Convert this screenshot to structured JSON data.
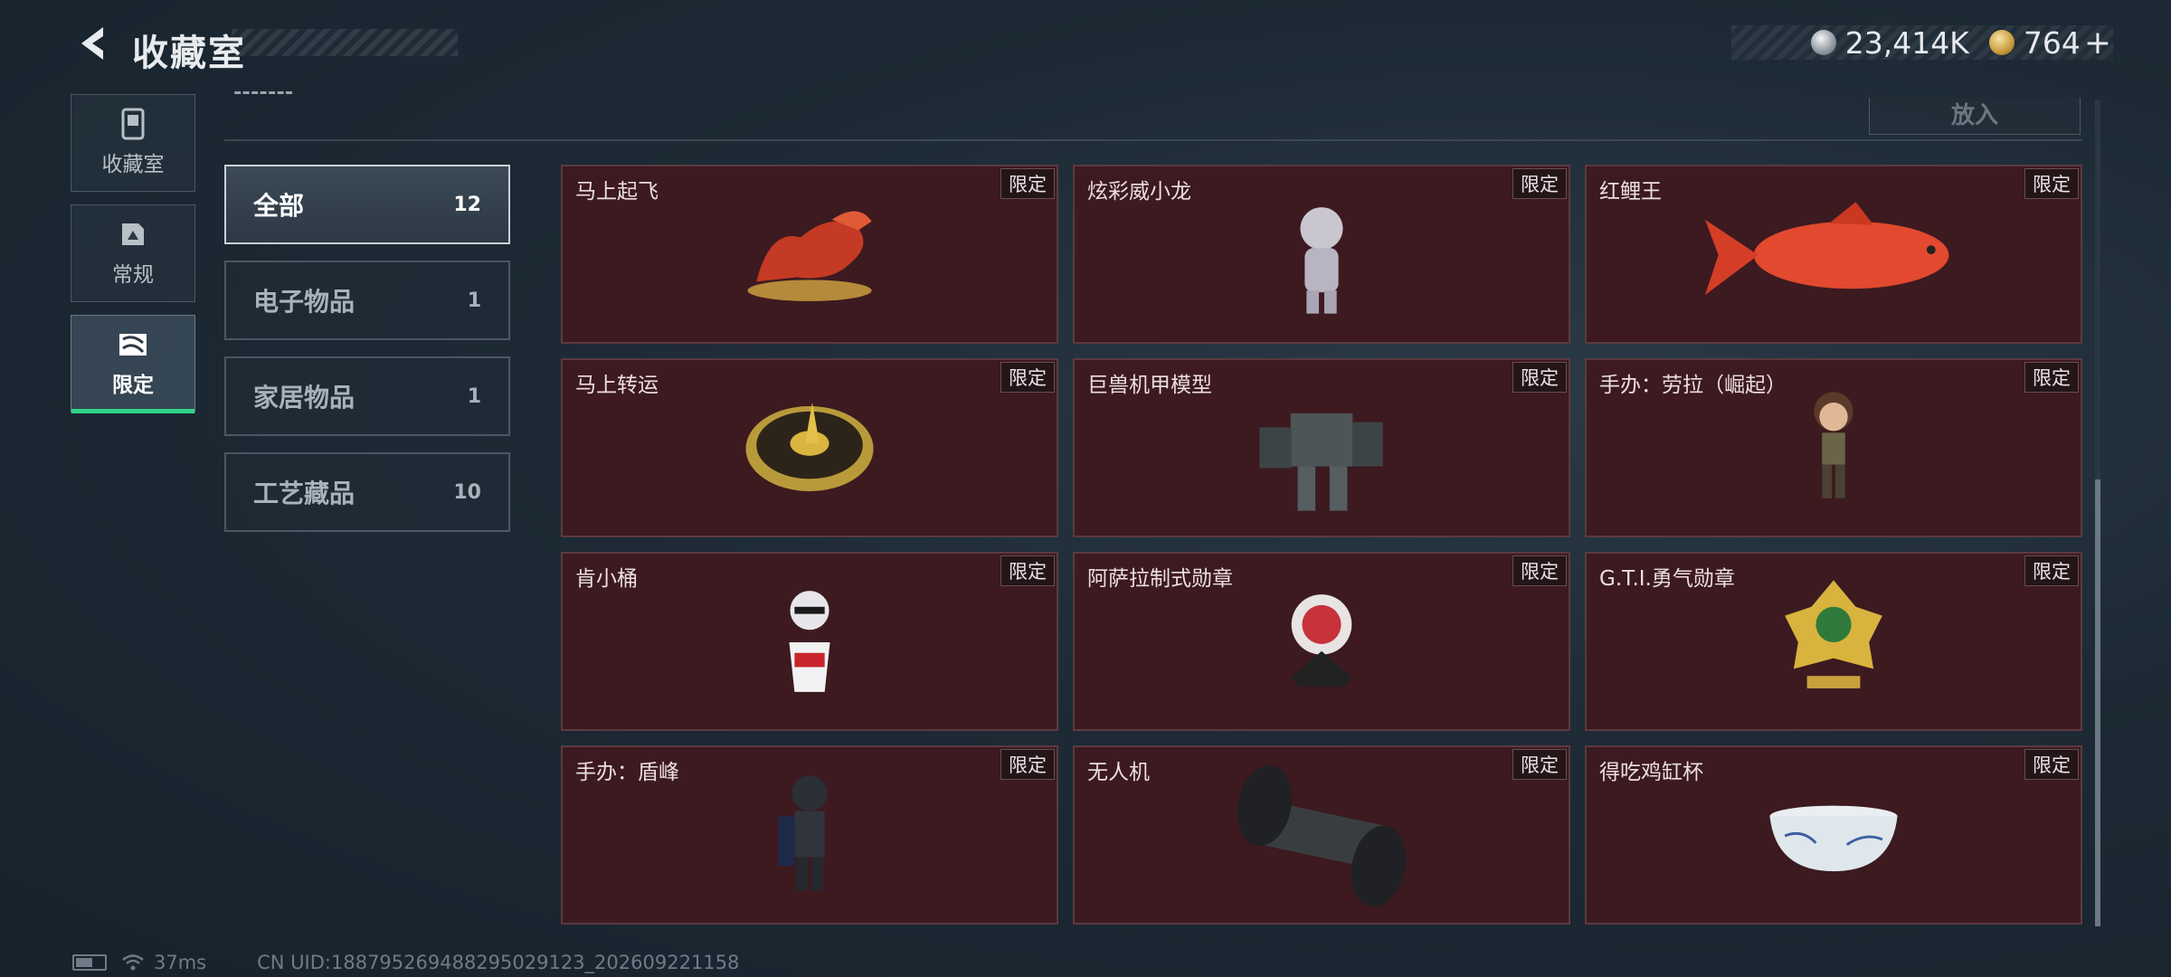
{
  "header": {
    "title": "收藏室",
    "currency": [
      {
        "icon": "silver-coin-icon",
        "value": "23,414K"
      },
      {
        "icon": "gold-coin-icon",
        "value": "764"
      }
    ],
    "add_symbol": "+"
  },
  "side_nav": [
    {
      "label": "收藏室",
      "icon": "collection-icon",
      "active": false
    },
    {
      "label": "常规",
      "icon": "regular-icon",
      "active": false
    },
    {
      "label": "限定",
      "icon": "limited-icon",
      "active": true
    }
  ],
  "toolbar": {
    "put_in_label": "放入"
  },
  "categories": [
    {
      "name": "全部",
      "count": "12",
      "active": true
    },
    {
      "name": "电子物品",
      "count": "1",
      "active": false
    },
    {
      "name": "家居物品",
      "count": "1",
      "active": false
    },
    {
      "name": "工艺藏品",
      "count": "10",
      "active": false
    }
  ],
  "items": [
    {
      "name": "马上起飞",
      "tag": "限定",
      "icon": "red-horse-sculpture-icon"
    },
    {
      "name": "炫彩威小龙",
      "tag": "限定",
      "icon": "silver-dragon-figure-icon"
    },
    {
      "name": "红鲤王",
      "tag": "限定",
      "icon": "red-carp-fish-icon"
    },
    {
      "name": "马上转运",
      "tag": "限定",
      "icon": "golden-horse-spinner-icon"
    },
    {
      "name": "巨兽机甲模型",
      "tag": "限定",
      "icon": "mech-model-icon"
    },
    {
      "name": "手办：劳拉（崛起）",
      "tag": "限定",
      "icon": "lara-figure-icon"
    },
    {
      "name": "肯小桶",
      "tag": "限定",
      "icon": "bucket-figure-icon"
    },
    {
      "name": "阿萨拉制式勋章",
      "tag": "限定",
      "icon": "asala-medal-icon"
    },
    {
      "name": "G.T.I.勇气勋章",
      "tag": "限定",
      "icon": "gti-medal-icon"
    },
    {
      "name": "手办：盾峰",
      "tag": "限定",
      "icon": "shield-soldier-figure-icon"
    },
    {
      "name": "无人机",
      "tag": "限定",
      "icon": "drone-roller-icon"
    },
    {
      "name": "得吃鸡缸杯",
      "tag": "限定",
      "icon": "porcelain-cup-icon"
    }
  ],
  "status": {
    "ping": "37ms",
    "uid": "CN UID:188795269488295029123_202609221158"
  },
  "colors": {
    "accent_green": "#2fd58a",
    "card_bg": "#3c1a20",
    "page_bg": "#1d2a35"
  }
}
